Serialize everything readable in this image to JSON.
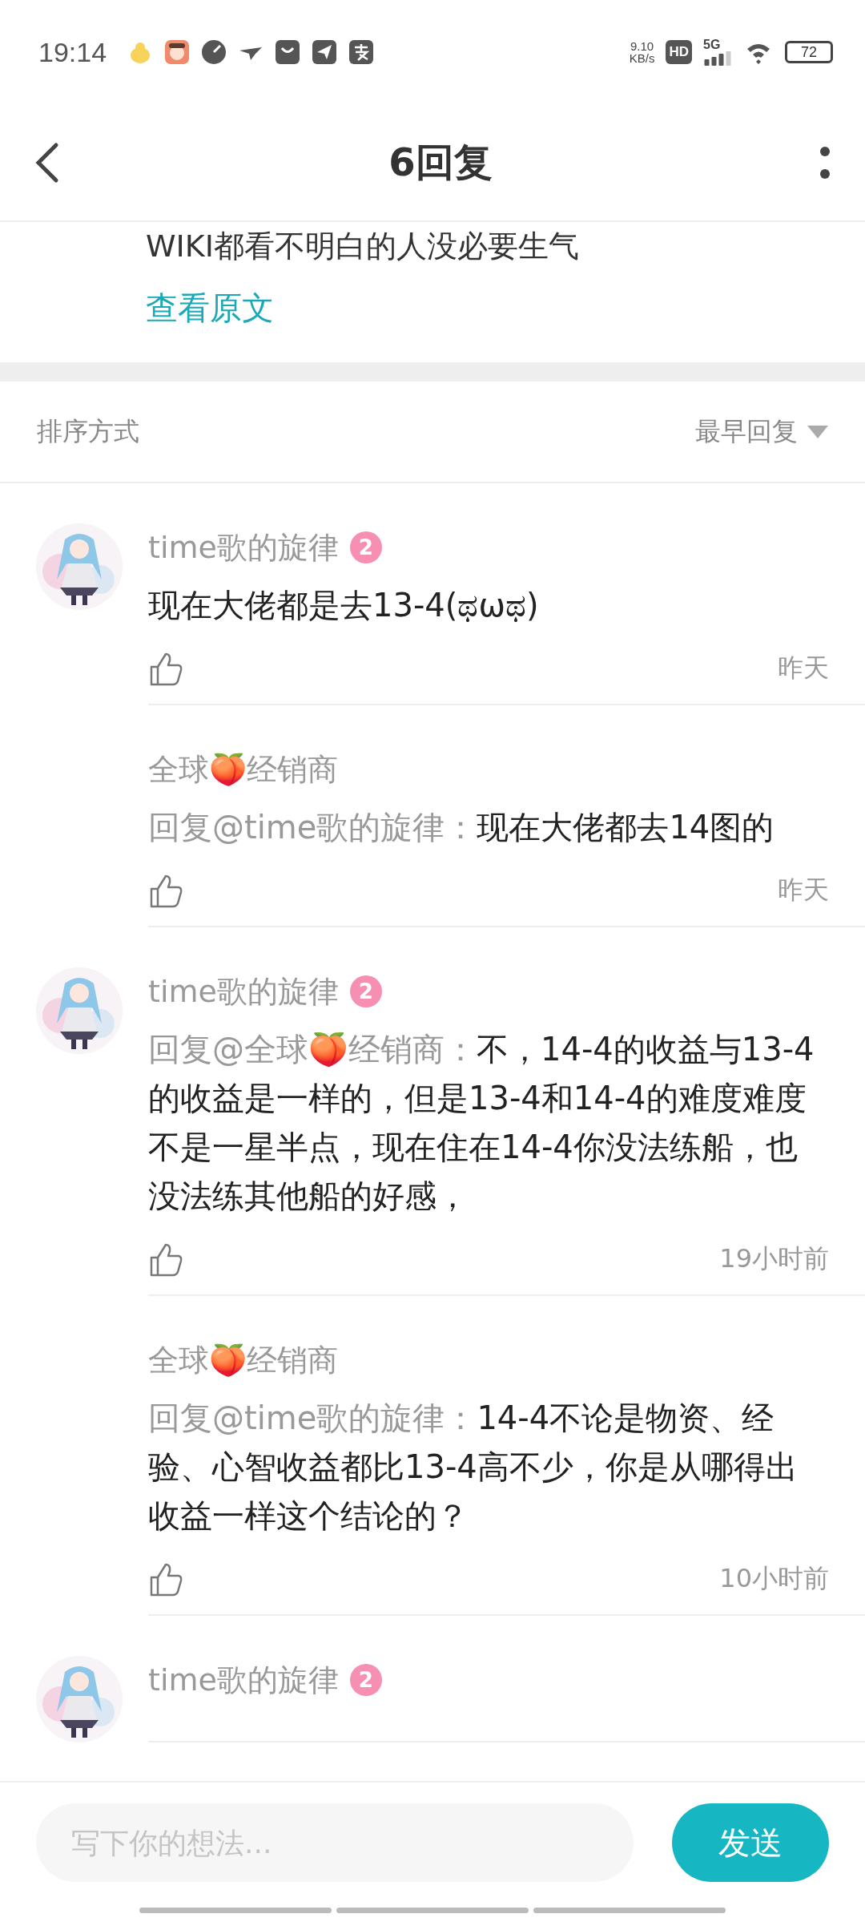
{
  "status_bar": {
    "time": "19:14",
    "speed": "9.10",
    "speed_unit": "KB/s",
    "hd": "HD",
    "network": "5G",
    "battery": "72"
  },
  "header": {
    "title": "6回复"
  },
  "original_post": {
    "text": "WIKI都看不明白的人没必要生气",
    "link": "查看原文"
  },
  "sort": {
    "label": "排序方式",
    "value": "最早回复"
  },
  "comments": [
    {
      "name": "time歌的旋律",
      "badge": "2",
      "text": "现在大佬都是去13-4(ಥωಥ)",
      "time": "昨天"
    },
    {
      "name": "全球🍑经销商",
      "mention": "回复@time歌的旋律：",
      "text": "现在大佬都去14图的",
      "time": "昨天"
    },
    {
      "name": "time歌的旋律",
      "badge": "2",
      "mention": "回复@全球🍑经销商：",
      "text": "不，14-4的收益与13-4的收益是一样的，但是13-4和14-4的难度难度不是一星半点，现在住在14-4你没法练船，也没法练其他船的好感，",
      "time": "19小时前"
    },
    {
      "name": "全球🍑经销商",
      "mention": "回复@time歌的旋律：",
      "text": "14-4不论是物资、经验、心智收益都比13-4高不少，你是从哪得出收益一样这个结论的？",
      "time": "10小时前"
    },
    {
      "name": "time歌的旋律",
      "badge": "2"
    }
  ],
  "composer": {
    "placeholder": "写下你的想法...",
    "send": "发送"
  }
}
